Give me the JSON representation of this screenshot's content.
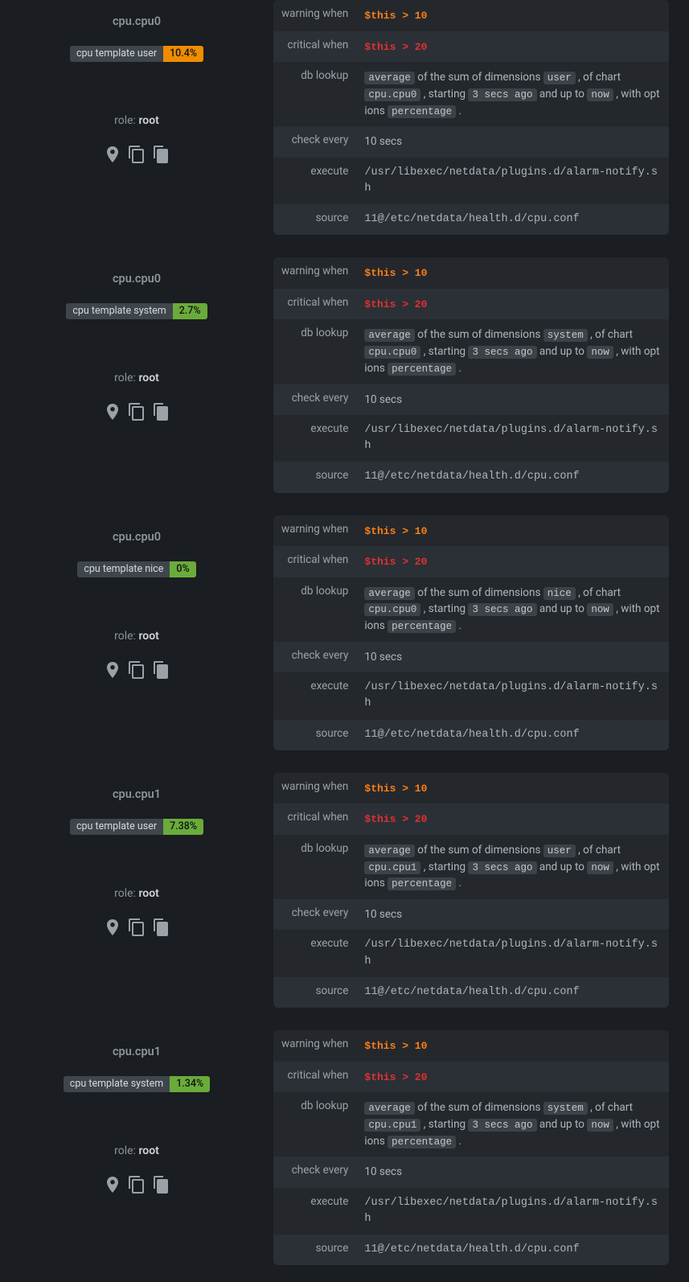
{
  "labels": {
    "warning": "warning when",
    "critical": "critical when",
    "lookup": "db lookup",
    "check": "check every",
    "execute": "execute",
    "source": "source",
    "role": "role: "
  },
  "lookup_parts": {
    "t0": " of the sum of dimensions ",
    "t1": " , of chart ",
    "t2": " , starting ",
    "t3": "  and up to ",
    "t4": " , with options ",
    "t5": " .",
    "avg": "average",
    "ago": "3 secs ago",
    "now": "now",
    "pct": "percentage"
  },
  "common": {
    "warn_expr": "$this > 10",
    "crit_expr": "$this > 20",
    "check_every": "10 secs",
    "execute": "/usr/libexec/netdata/plugins.d/alarm-notify.sh",
    "source": "11@/etc/netdata/health.d/cpu.conf",
    "role": "root"
  },
  "cards": [
    {
      "chart": "cpu.cpu0",
      "badge_label": "cpu template user",
      "badge_val": "10.4%",
      "badge_color": "#f08c00",
      "dim": "user",
      "chart_code": "cpu.cpu0"
    },
    {
      "chart": "cpu.cpu0",
      "badge_label": "cpu template system",
      "badge_val": "2.7%",
      "badge_color": "#6aab3a",
      "dim": "system",
      "chart_code": "cpu.cpu0"
    },
    {
      "chart": "cpu.cpu0",
      "badge_label": "cpu template nice",
      "badge_val": "0%",
      "badge_color": "#6aab3a",
      "dim": "nice",
      "chart_code": "cpu.cpu0"
    },
    {
      "chart": "cpu.cpu1",
      "badge_label": "cpu template user",
      "badge_val": "7.38%",
      "badge_color": "#6aab3a",
      "dim": "user",
      "chart_code": "cpu.cpu1"
    },
    {
      "chart": "cpu.cpu1",
      "badge_label": "cpu template system",
      "badge_val": "1.34%",
      "badge_color": "#6aab3a",
      "dim": "system",
      "chart_code": "cpu.cpu1"
    }
  ]
}
